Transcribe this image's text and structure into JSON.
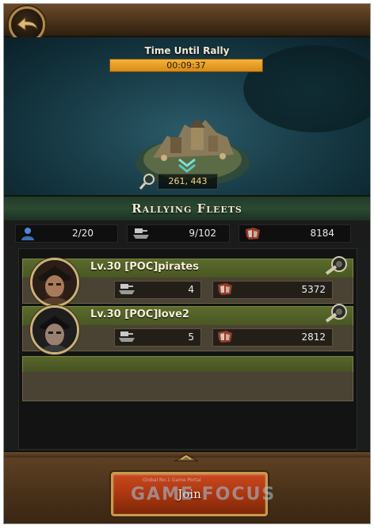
{
  "map": {
    "timer_title": "Time Until Rally",
    "timer_value": "00:09:37",
    "coordinates": "261, 443"
  },
  "header": {
    "title": "Rallying Fleets"
  },
  "stats": {
    "members": "2/20",
    "ships": "9/102",
    "power": "8184"
  },
  "fleets": [
    {
      "name": "Lv.30 [POC]pirates",
      "ships": "4",
      "power": "5372"
    },
    {
      "name": "Lv.30 [POC]love2",
      "ships": "5",
      "power": "2812"
    }
  ],
  "footer": {
    "join_label": "Join",
    "watermark": "GAME FOCUS",
    "watermark_small": "Global No.1 Game Portal"
  },
  "colors": {
    "timer_bar": "#e19a22",
    "join_button": "#b23c12",
    "fleet_name_bar": "#54622a"
  },
  "icons": [
    "back-arrow-icon",
    "magnifier-icon",
    "member-icon",
    "ship-icon",
    "power-icon",
    "spyglass-icon"
  ]
}
